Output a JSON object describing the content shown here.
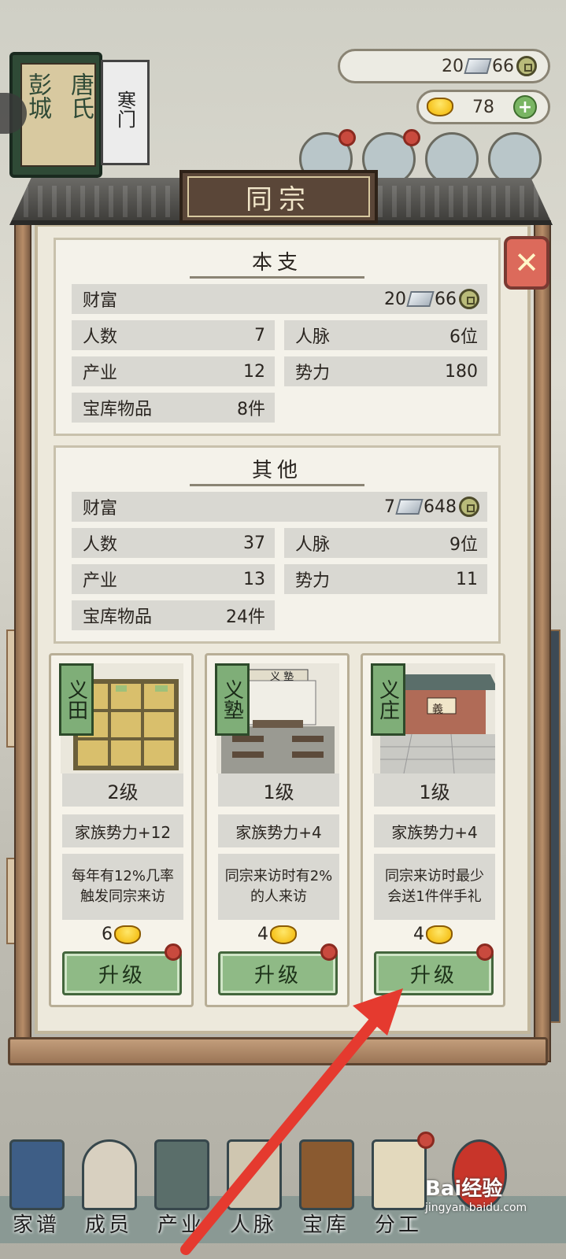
{
  "resources": {
    "silver": "20",
    "coin": "66",
    "gold": "78"
  },
  "book": {
    "name_part1": "唐氏",
    "name_part2": "彭城",
    "rank": "寒门"
  },
  "dialog": {
    "title": "同宗",
    "sections": [
      {
        "title": "本支",
        "wealth_label": "财富",
        "wealth_silver": "20",
        "wealth_coin": "66",
        "rows": [
          {
            "label": "人数",
            "value": "7"
          },
          {
            "label": "人脉",
            "value": "6位"
          },
          {
            "label": "产业",
            "value": "12"
          },
          {
            "label": "势力",
            "value": "180"
          },
          {
            "label": "宝库物品",
            "value": "8件"
          }
        ]
      },
      {
        "title": "其他",
        "wealth_label": "财富",
        "wealth_silver": "7",
        "wealth_coin": "648",
        "rows": [
          {
            "label": "人数",
            "value": "37"
          },
          {
            "label": "人脉",
            "value": "9位"
          },
          {
            "label": "产业",
            "value": "13"
          },
          {
            "label": "势力",
            "value": "11"
          },
          {
            "label": "宝库物品",
            "value": "24件"
          }
        ]
      }
    ],
    "cards": [
      {
        "tag": "义田",
        "level": "2级",
        "bonus": "家族势力+12",
        "desc": "每年有12%几率触发同宗来访",
        "cost": "6",
        "button": "升级"
      },
      {
        "tag": "义塾",
        "level": "1级",
        "bonus": "家族势力+4",
        "desc": "同宗来访时有2%的人来访",
        "cost": "4",
        "button": "升级",
        "sign": "义 塾"
      },
      {
        "tag": "义庄",
        "level": "1级",
        "bonus": "家族势力+4",
        "desc": "同宗来访时最少会送1件伴手礼",
        "cost": "4",
        "button": "升级",
        "sign": "義"
      }
    ]
  },
  "nav": [
    "家谱",
    "成员",
    "产业",
    "人脉",
    "宝库",
    "分工"
  ],
  "watermark": {
    "brand": "Bai经验",
    "url": "jingyan.baidu.com"
  },
  "colors": {
    "panel_bg": "#ede9dc",
    "button_green": "#8fba86",
    "close_red": "#dc6a5b",
    "arrow_red": "#e53a2f"
  }
}
